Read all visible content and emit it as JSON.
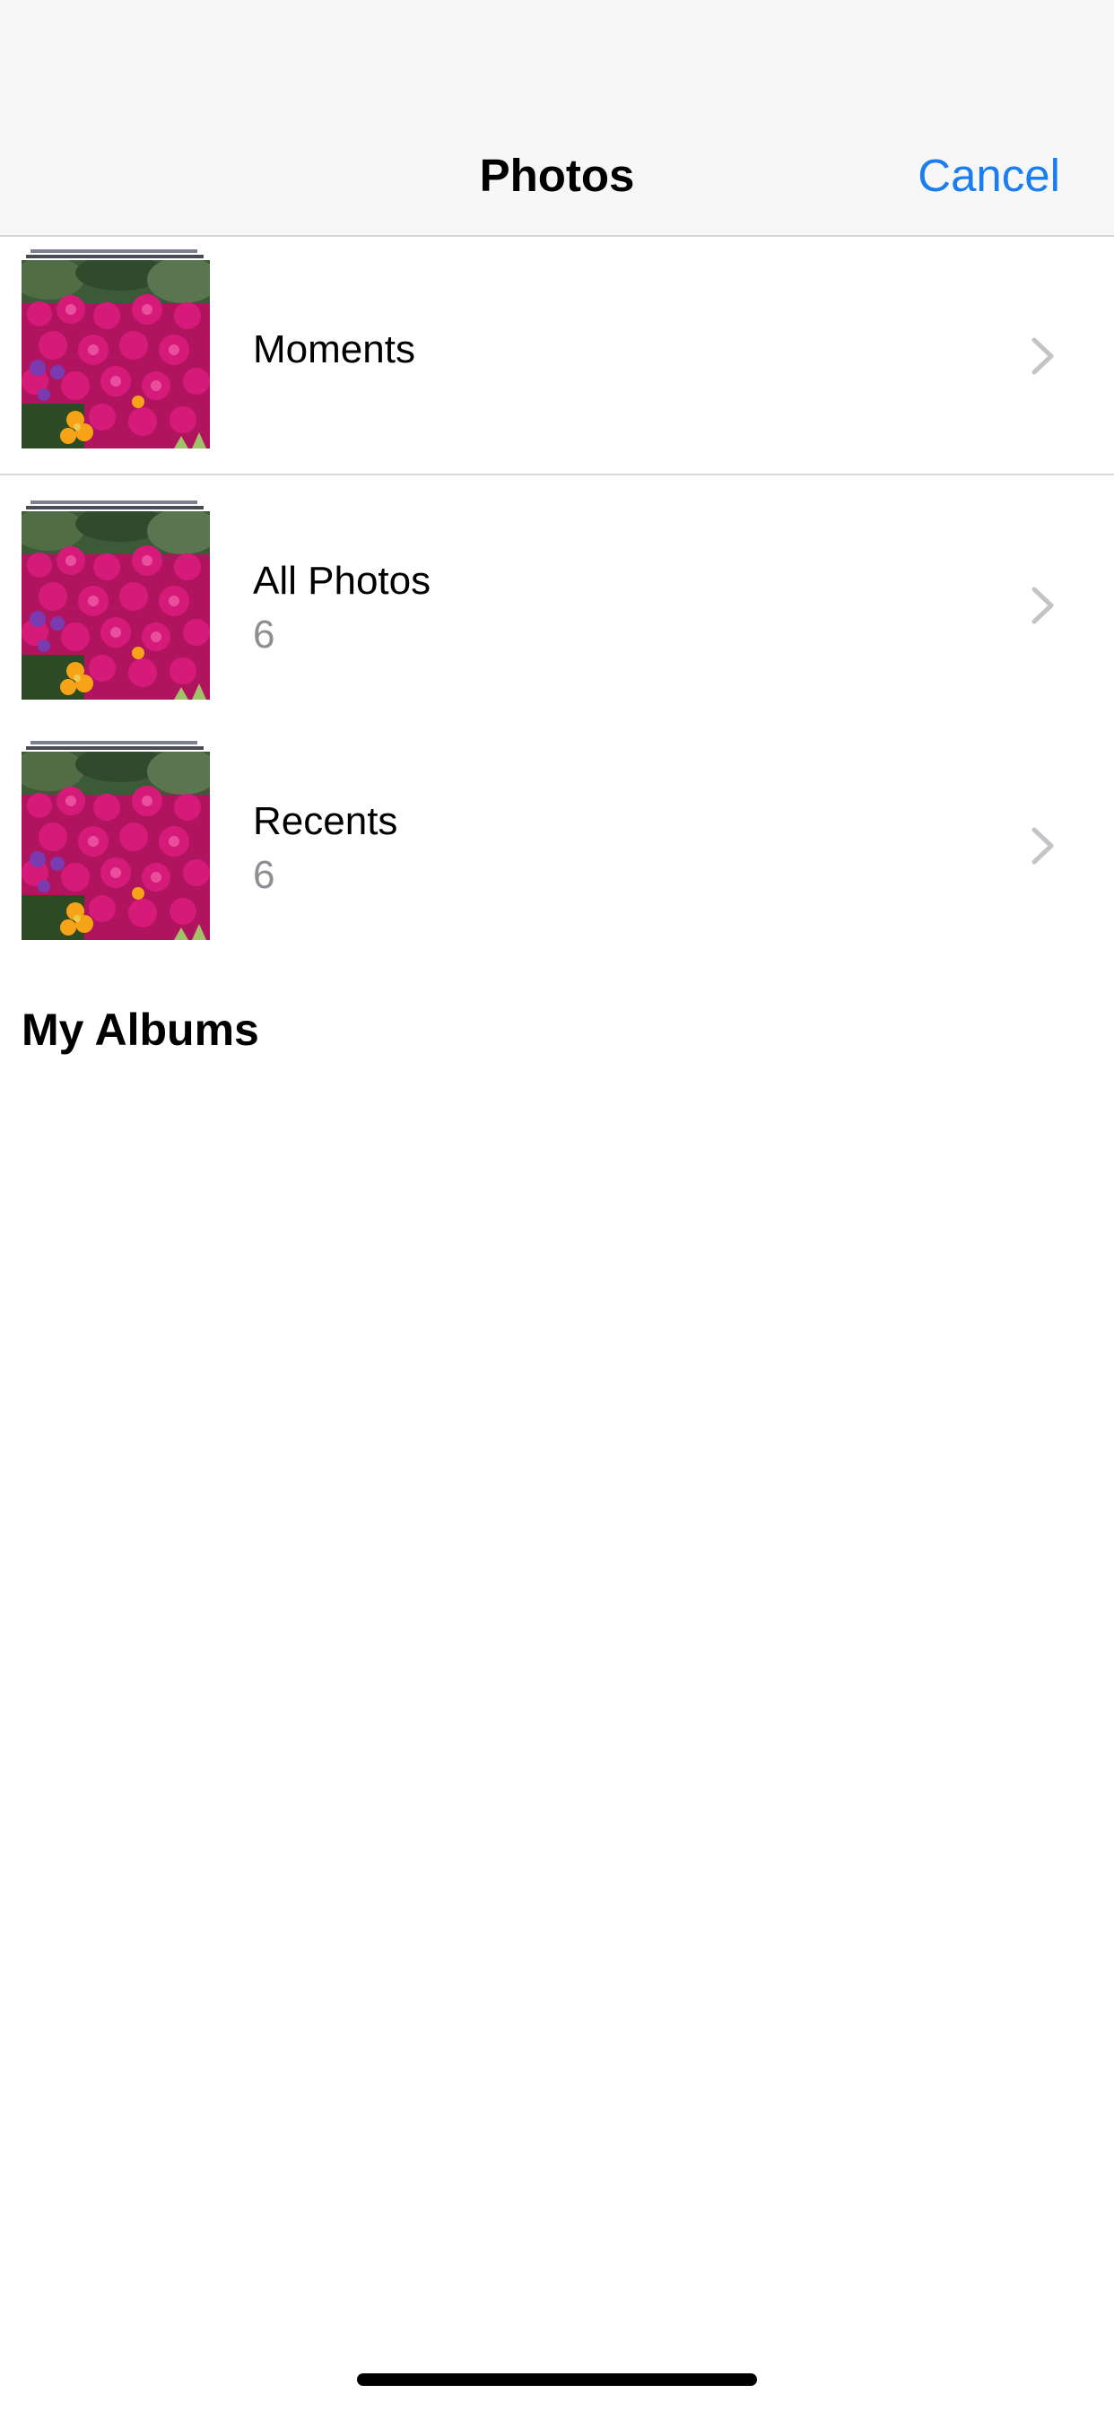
{
  "navbar": {
    "title": "Photos",
    "cancel_label": "Cancel"
  },
  "albums": [
    {
      "title": "Moments",
      "count": ""
    },
    {
      "title": "All Photos",
      "count": "6"
    },
    {
      "title": "Recents",
      "count": "6"
    }
  ],
  "sections": {
    "my_albums": "My Albums"
  },
  "colors": {
    "accent": "#1a7ef0",
    "secondary_text": "#8e8e93",
    "navbar_bg": "#f7f7f7",
    "separator": "#d6d6d8"
  },
  "icons": {
    "disclosure": "chevron-right-icon"
  }
}
